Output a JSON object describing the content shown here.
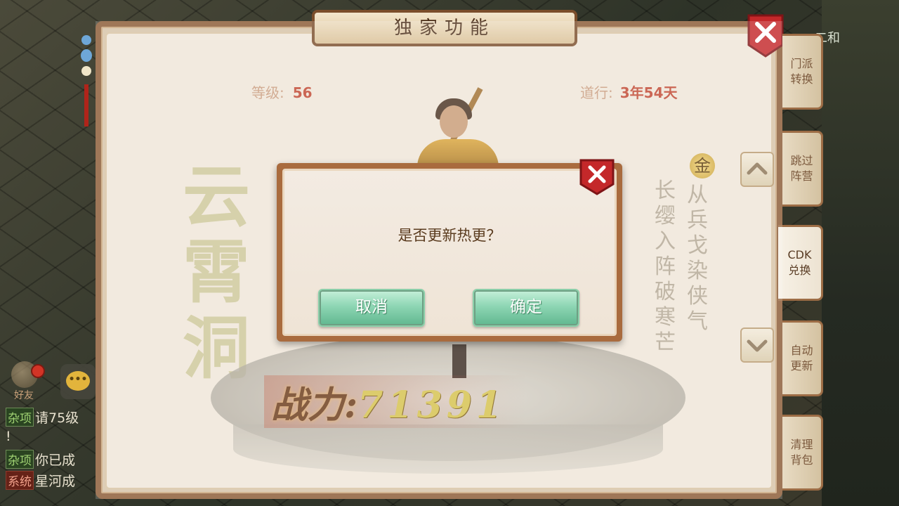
{
  "background": {
    "corner_text": "二和"
  },
  "chat": {
    "friend_label": "好友",
    "lines": [
      {
        "tag": "杂项",
        "text": "请75级"
      },
      {
        "tag": "",
        "text": "!"
      },
      {
        "tag": "杂项",
        "text": "你已成"
      },
      {
        "tag": "系统",
        "text": "星河成"
      }
    ]
  },
  "panel": {
    "title": "独家功能",
    "level_label": "等级:",
    "level_value": "56",
    "dao_label": "道行:",
    "dao_value": "3年54天",
    "calligraphy_big": "云霄洞",
    "poem_col_1": "从兵戈染侠气",
    "poem_col_2": "长缨入阵破寒芒",
    "gold_badge": "金",
    "power_label": "战力:",
    "power_value": "71391"
  },
  "side_tabs": [
    {
      "label_1": "门派",
      "label_2": "转换"
    },
    {
      "label_1": "跳过",
      "label_2": "阵营"
    },
    {
      "label_1": "CDK",
      "label_2": "兑换"
    },
    {
      "label_1": "自动",
      "label_2": "更新"
    },
    {
      "label_1": "清理",
      "label_2": "背包"
    }
  ],
  "dialog": {
    "message": "是否更新热更？",
    "cancel_label": "取消",
    "confirm_label": "确定"
  },
  "colors": {
    "panel_border": "#8a5a34",
    "close_red": "#c4282a",
    "button_green": "#8ed6b4",
    "value_red": "#c04630"
  }
}
